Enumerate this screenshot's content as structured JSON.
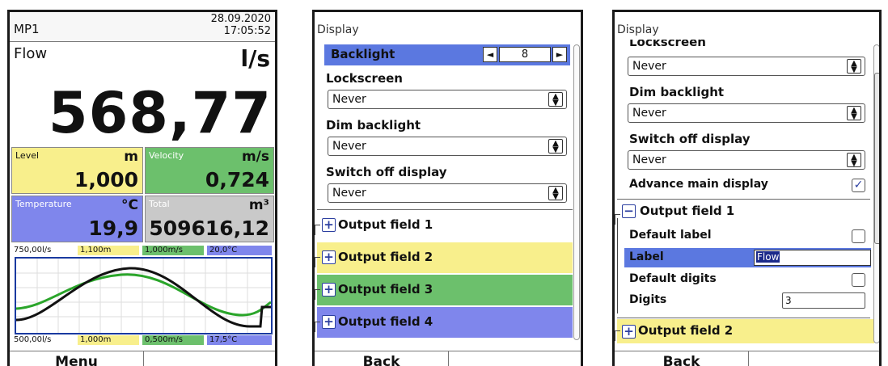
{
  "screen1": {
    "device": "MP1",
    "date": "28.09.2020",
    "time": "17:05:52",
    "main": {
      "label": "Flow",
      "unit": "l/s",
      "value": "568,77"
    },
    "tiles": {
      "level": {
        "label": "Level",
        "unit": "m",
        "value": "1,000"
      },
      "velocity": {
        "label": "Velocity",
        "unit": "m/s",
        "value": "0,724"
      },
      "temperature": {
        "label": "Temperature",
        "unit": "°C",
        "value": "19,9"
      },
      "total": {
        "label": "Total",
        "unit": "m³",
        "value": "509616,12"
      }
    },
    "scale_top": [
      "750,00l/s",
      "1,100m",
      "1,000m/s",
      "20,0°C"
    ],
    "scale_bottom": [
      "500,00l/s",
      "1,000m",
      "0,500m/s",
      "17,5°C"
    ],
    "menu_button": "Menu"
  },
  "screen2": {
    "title": "Display",
    "backlight": {
      "label": "Backlight",
      "value": "8",
      "left": "◄",
      "right": "►"
    },
    "lockscreen": {
      "label": "Lockscreen",
      "value": "Never"
    },
    "dim_backlight": {
      "label": "Dim backlight",
      "value": "Never"
    },
    "switch_off": {
      "label": "Switch off display",
      "value": "Never"
    },
    "output_fields": [
      "Output field 1",
      "Output field 2",
      "Output field 3",
      "Output field 4"
    ],
    "expand_symbol": "+",
    "back_button": "Back"
  },
  "screen3": {
    "title": "Display",
    "lockscreen": {
      "label": "Lockscreen",
      "value": "Never"
    },
    "dim_backlight": {
      "label": "Dim backlight",
      "value": "Never"
    },
    "switch_off": {
      "label": "Switch off display",
      "value": "Never"
    },
    "advance": {
      "label": "Advance main display",
      "checked": true,
      "check": "✓"
    },
    "output_field_1": {
      "label": "Output field 1",
      "symbol": "−"
    },
    "default_label": {
      "label": "Default label",
      "checked": false
    },
    "label": {
      "label": "Label",
      "value": "Flow"
    },
    "default_digits": {
      "label": "Default digits",
      "checked": false
    },
    "digits": {
      "label": "Digits",
      "value": "3"
    },
    "output_field_2": {
      "label": "Output field 2",
      "symbol": "+"
    },
    "back_button": "Back"
  },
  "colors": {
    "yellow": "#f8ef8c",
    "green": "#6cc06c",
    "blue": "#7f86ec",
    "gray": "#c9c9c9",
    "highlight": "#5b78e0"
  }
}
